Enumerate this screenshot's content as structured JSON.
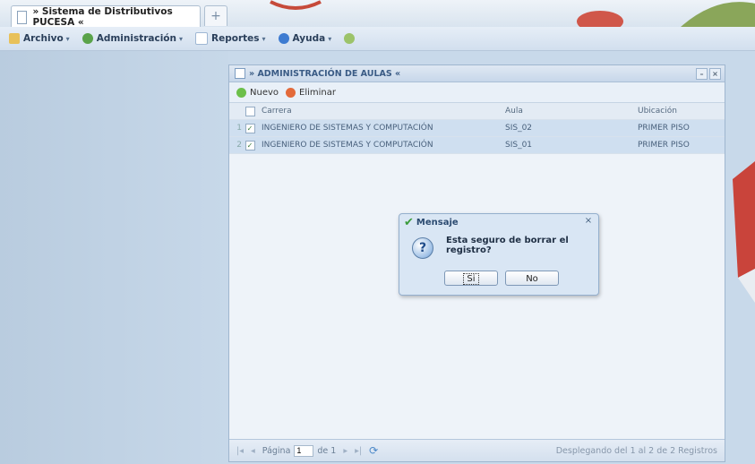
{
  "app_tab": {
    "title": "» Sistema de Distributivos PUCESA «",
    "add_label": "+"
  },
  "menubar": [
    {
      "label": "Archivo",
      "icon": "folder-icon",
      "color": "#e8c15a"
    },
    {
      "label": "Administración",
      "icon": "admin-icon",
      "color": "#5aa34a"
    },
    {
      "label": "Reportes",
      "icon": "report-icon",
      "color": "#9fb7d4"
    },
    {
      "label": "Ayuda",
      "icon": "help-icon",
      "color": "#3d7bd1"
    }
  ],
  "window": {
    "title": "» ADMINISTRACIÓN DE AULAS «",
    "toolbar": {
      "new_label": "Nuevo",
      "delete_label": "Eliminar"
    },
    "grid": {
      "columns": [
        "Carrera",
        "Aula",
        "Ubicación"
      ],
      "rows": [
        {
          "num": "1",
          "checked": true,
          "carrera": "INGENIERO DE SISTEMAS Y COMPUTACIÓN",
          "aula": "SIS_02",
          "ubicacion": "PRIMER PISO"
        },
        {
          "num": "2",
          "checked": true,
          "carrera": "INGENIERO DE SISTEMAS Y COMPUTACIÓN",
          "aula": "SIS_01",
          "ubicacion": "PRIMER PISO"
        }
      ]
    },
    "paging": {
      "page_label": "Página",
      "page_value": "1",
      "of_label": "de 1",
      "info": "Desplegando del 1 al 2 de 2 Registros"
    }
  },
  "dialog": {
    "title": "Mensaje",
    "message": "Esta seguro de borrar el registro?",
    "yes_label": "Si",
    "no_label": "No"
  },
  "colors": {
    "accent": "#3a5b85",
    "selection": "#cfdff0",
    "success": "#3a9b3a"
  }
}
